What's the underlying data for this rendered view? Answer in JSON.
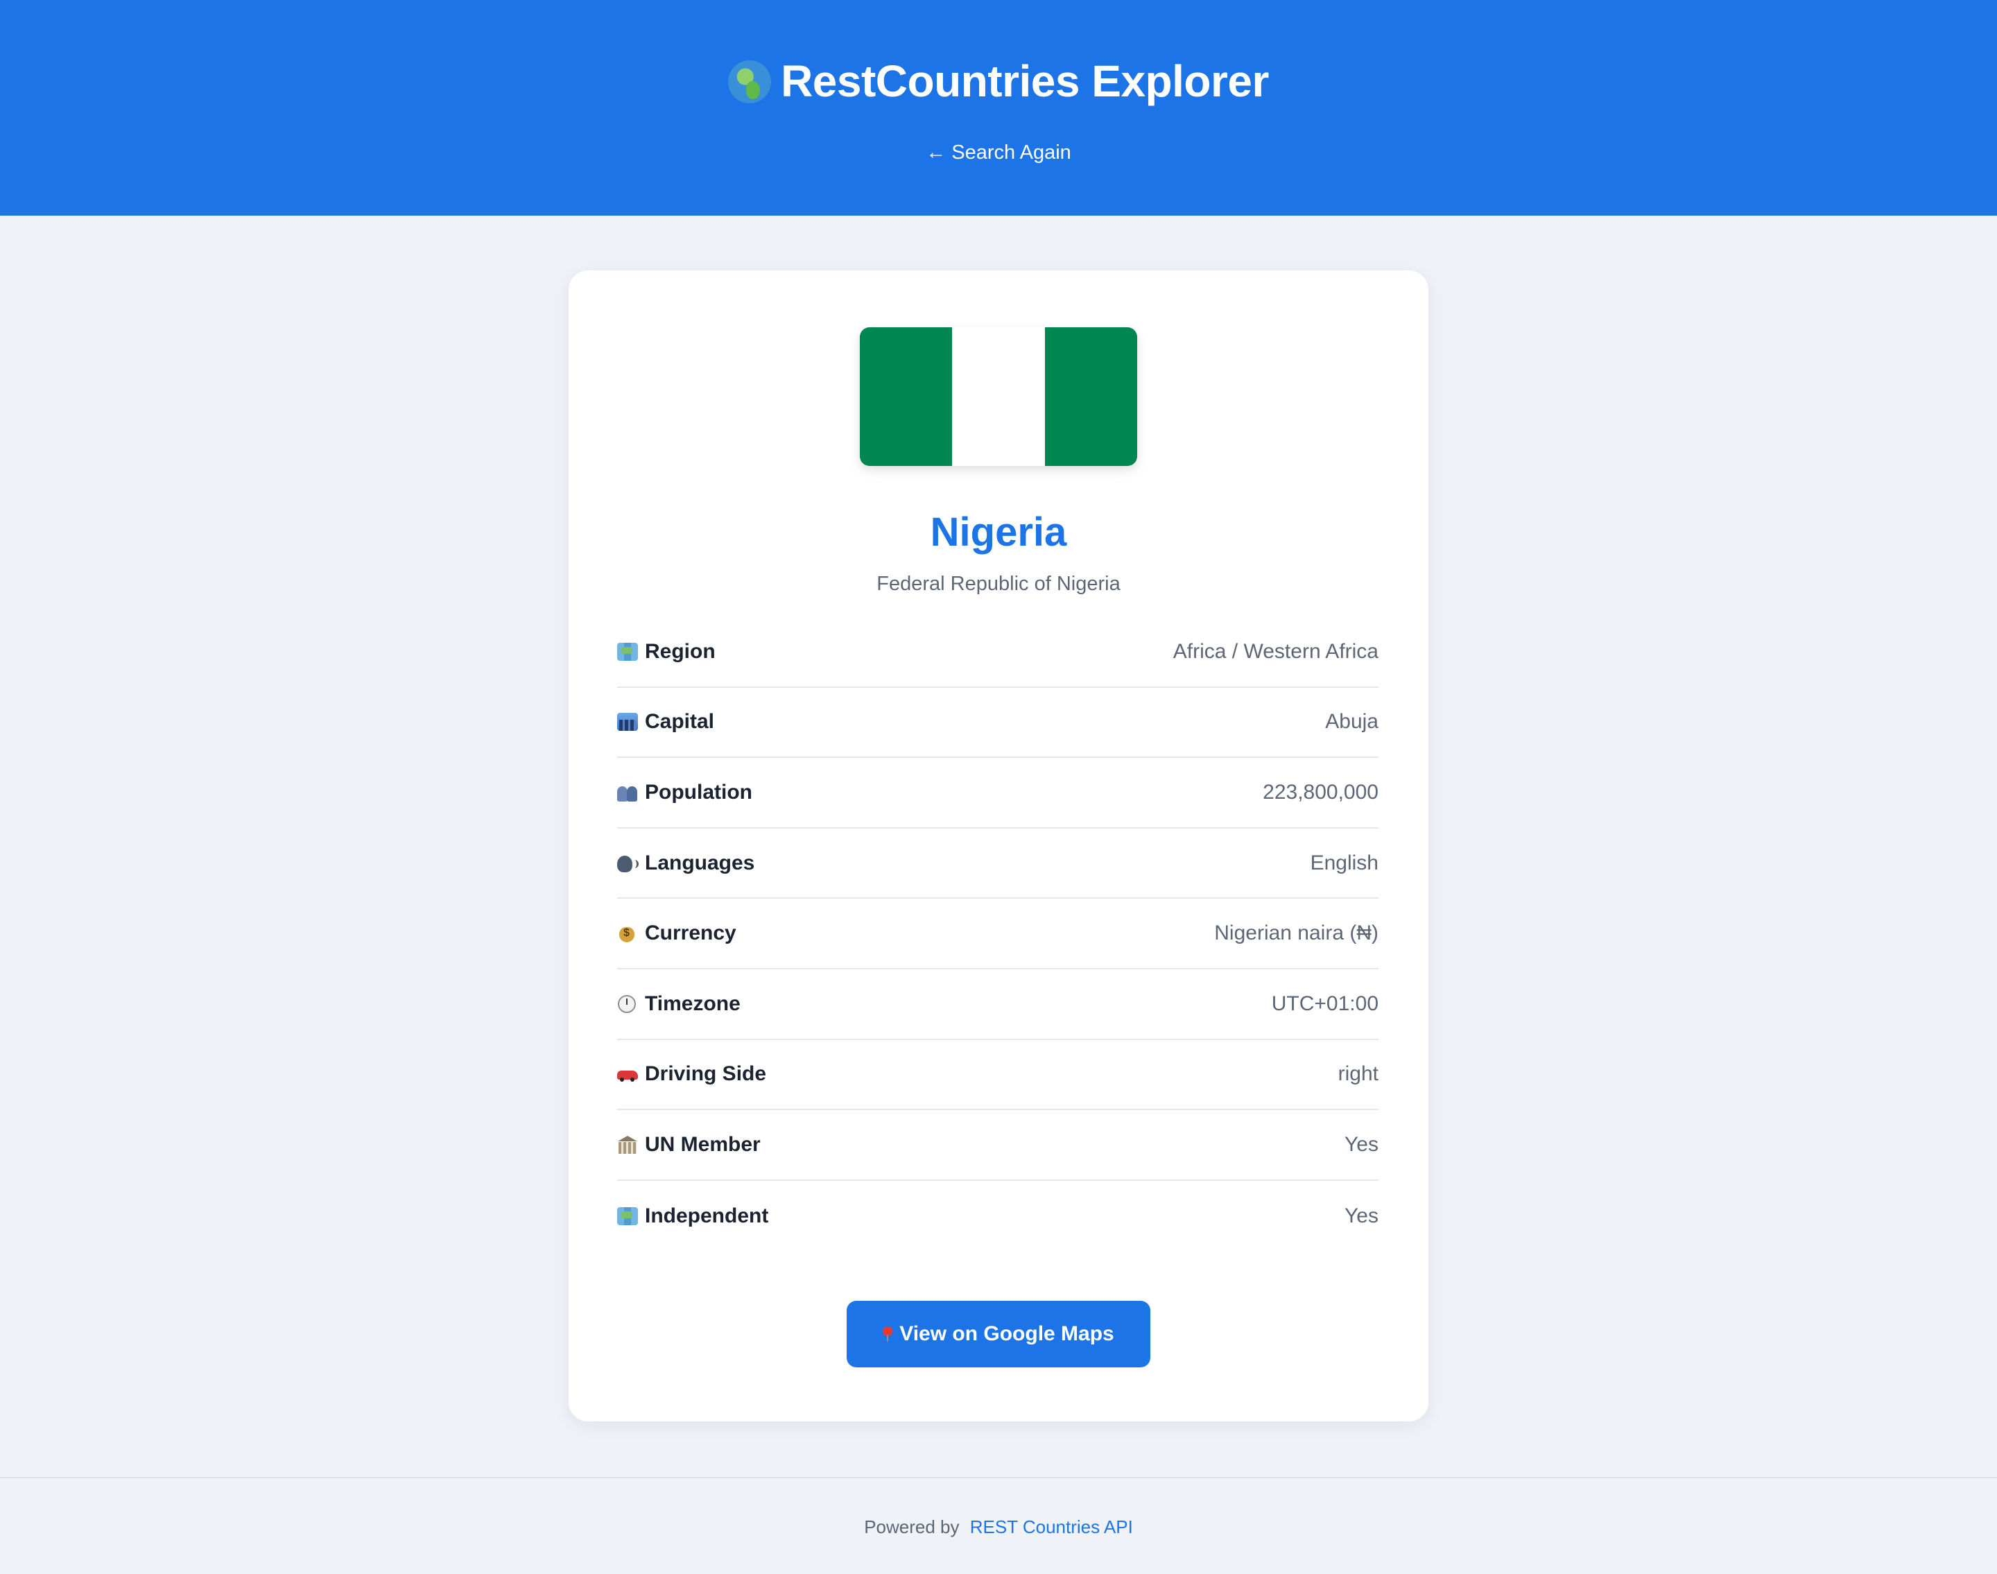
{
  "header": {
    "title": "RestCountries Explorer",
    "back_link": "← Search Again"
  },
  "country": {
    "name": "Nigeria",
    "official_name": "Federal Republic of Nigeria",
    "flag_colors": [
      "#008751",
      "#ffffff",
      "#008751"
    ]
  },
  "details": [
    {
      "icon": "map-icon",
      "label": "Region",
      "value": "Africa / Western Africa"
    },
    {
      "icon": "city-icon",
      "label": "Capital",
      "value": "Abuja"
    },
    {
      "icon": "people-icon",
      "label": "Population",
      "value": "223,800,000"
    },
    {
      "icon": "speaking-head-icon",
      "label": "Languages",
      "value": "English"
    },
    {
      "icon": "money-bag-icon",
      "label": "Currency",
      "value": "Nigerian naira (₦)"
    },
    {
      "icon": "clock-icon",
      "label": "Timezone",
      "value": "UTC+01:00"
    },
    {
      "icon": "car-icon",
      "label": "Driving Side",
      "value": "right"
    },
    {
      "icon": "bank-icon",
      "label": "UN Member",
      "value": "Yes"
    },
    {
      "icon": "map-icon",
      "label": "Independent",
      "value": "Yes"
    }
  ],
  "actions": {
    "maps_button": "View on Google Maps",
    "maps_icon": "pin-icon"
  },
  "footer": {
    "prefix": "Powered by",
    "link_text": "REST Countries API"
  },
  "colors": {
    "accent": "#1c74e6",
    "background": "#eff2f7",
    "card": "#ffffff"
  }
}
